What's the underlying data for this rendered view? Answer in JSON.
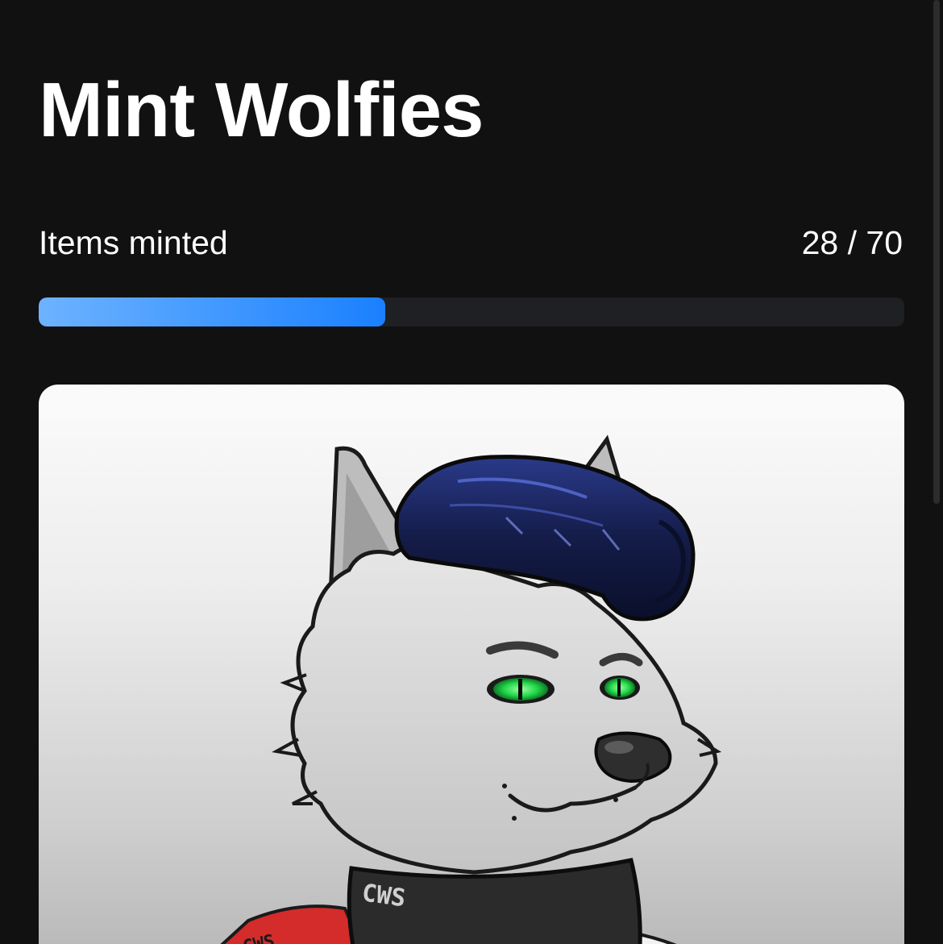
{
  "header": {
    "title": "Mint Wolfies"
  },
  "mint_progress": {
    "label": "Items minted",
    "count_text": "28 / 70",
    "minted": 28,
    "total": 70,
    "fraction": 0.4,
    "fill_color_start": "#6db3ff",
    "fill_color_end": "#1a80ff",
    "track_color": "#1f2023"
  },
  "nft_preview": {
    "collar_text": "CWS",
    "sleeve_text": "CWS",
    "hair_color": "#1b2456",
    "eye_color": "#22d84a",
    "fur_color": "#d9d9d9",
    "jacket_color": "#d42b2b"
  },
  "colors": {
    "background": "#111112",
    "text": "#ffffff"
  }
}
